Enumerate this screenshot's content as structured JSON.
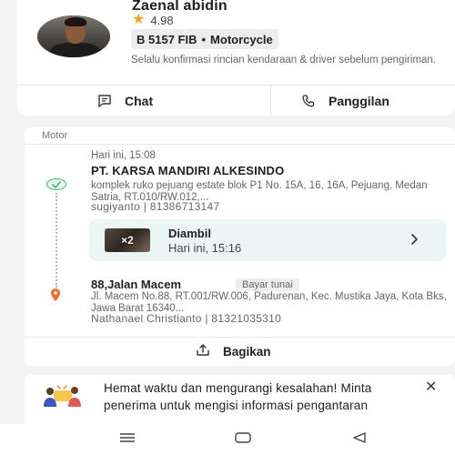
{
  "driver": {
    "name": "Zaenal abidin",
    "rating": "4.98",
    "plate": "B 5157 FIB",
    "separator": "•",
    "vehicle_type": "Motorcycle",
    "note": "Selalu konfirmasi rincian kendaraan & driver sebelum pengiriman."
  },
  "actions": {
    "chat_label": "Chat",
    "call_label": "Panggilan"
  },
  "delivery": {
    "section_label": "Motor",
    "pickup": {
      "time": "Hari ini, 15:08",
      "name": "PT. KARSA MANDIRI ALKESINDO",
      "address": "komplek ruko pejuang estate blok P1 No. 15A, 16, 16A, Pejuang, Medan Satria, RT.010/RW.012,...",
      "contact": "sugiyanto | 81386713147"
    },
    "status": {
      "thumbnail_badge": "×2",
      "title": "Diambil",
      "time": "Hari ini, 15:16"
    },
    "destination": {
      "name": "88,Jalan Macem",
      "payment_badge": "Bayar tunai",
      "address": "Jl. Macem No.88, RT.001/RW.006, Padurenan, Kec. Mustika Jaya, Kota Bks, Jawa Barat 16340...",
      "contact": "Nathanael Christianto | 81321035310"
    },
    "share_label": "Bagikan"
  },
  "tip": {
    "text": "Hemat waktu dan mengurangi kesalahan! Minta penerima untuk mengisi informasi pengantaran"
  },
  "colors": {
    "accent_green": "#3fb27f",
    "pin_orange": "#ef6c2d",
    "star_gold": "#f2a516",
    "status_bg": "#eaf5f4"
  },
  "icons": [
    "star-icon",
    "chat-icon",
    "phone-icon",
    "check-icon",
    "pin-icon",
    "chevron-right-icon",
    "share-icon",
    "close-icon",
    "menu-icon",
    "home-icon",
    "back-icon"
  ]
}
